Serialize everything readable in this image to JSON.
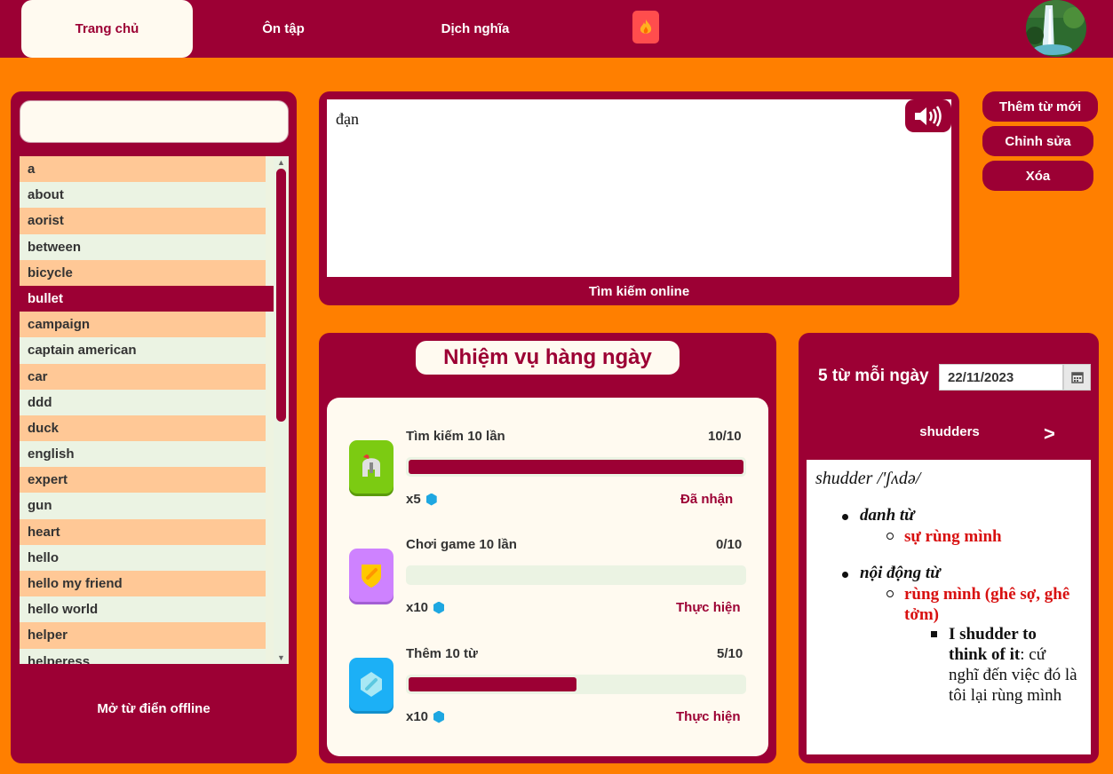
{
  "nav": {
    "tabs": [
      {
        "label": "Trang chủ"
      },
      {
        "label": "Ôn tập"
      },
      {
        "label": "Dịch nghĩa"
      }
    ]
  },
  "sidebar": {
    "search_value": "",
    "words": [
      "a",
      "about",
      "aorist",
      "between",
      "bicycle",
      "bullet",
      "campaign",
      "captain american",
      "car",
      "ddd",
      "duck",
      "english",
      "expert",
      "gun",
      "heart",
      "hello",
      "hello my friend",
      "hello world",
      "helper",
      "helperess"
    ],
    "selected": "bullet",
    "offline_label": "Mở từ điển offline"
  },
  "lookup": {
    "word": "đạn",
    "online_label": "Tìm kiếm online"
  },
  "actions": {
    "add": "Thêm từ mới",
    "edit": "Chỉnh sửa",
    "delete": "Xóa"
  },
  "quests": {
    "title": "Nhiệm vụ hàng ngày",
    "items": [
      {
        "name": "Tìm kiếm 10 lần",
        "progress": "10/10",
        "fraction": 1.0,
        "reward": "x5",
        "action": "Đã nhận"
      },
      {
        "name": "Chơi game 10 lần",
        "progress": "0/10",
        "fraction": 0.0,
        "reward": "x10",
        "action": "Thực hiện"
      },
      {
        "name": "Thêm 10 từ",
        "progress": "5/10",
        "fraction": 0.5,
        "reward": "x10",
        "action": "Thực hiện"
      }
    ]
  },
  "daily": {
    "label": "5 từ mỗi ngày",
    "date": "22/11/2023",
    "word": "shudders",
    "next": ">",
    "entry": {
      "headword": "shudder /'ʃʌdə/",
      "pos1": "danh từ",
      "meaning1": "sự rùng mình",
      "pos2": "nội động từ",
      "meaning2": "rùng mình (ghê sợ, ghê tởm)",
      "example_bold": "I shudder to think of it",
      "example_rest": ": cứ nghĩ đến việc đó là tôi lại rùng mình"
    }
  },
  "colors": {
    "primary": "#9c0034",
    "background": "#ff7f00",
    "cream": "#fffaf0",
    "row_odd": "#ffc896",
    "row_even": "#ebf3e3"
  }
}
